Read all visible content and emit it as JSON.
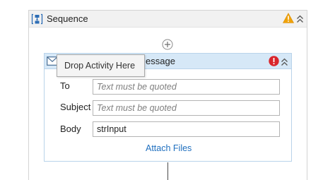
{
  "sequence": {
    "title": "Sequence",
    "icons": {
      "type": "sequence-icon",
      "warning": "warning-icon",
      "collapse": "collapse-icon",
      "add": "plus-circle-icon"
    }
  },
  "activity": {
    "title_visible": "essage",
    "icons": {
      "type": "mail-icon",
      "error": "error-icon",
      "collapse": "collapse-icon"
    },
    "tooltip": "Drop Activity Here",
    "fields": {
      "to": {
        "label": "To",
        "placeholder": "Text must be quoted"
      },
      "subject": {
        "label": "Subject",
        "placeholder": "Text must be quoted"
      },
      "body": {
        "label": "Body",
        "value": "strInput"
      }
    },
    "attach_label": "Attach Files"
  },
  "colors": {
    "accent_blue": "#1f6fbf",
    "header_blue": "#d6e8f7",
    "warning_orange": "#f0a30a",
    "error_red": "#d9262c"
  }
}
